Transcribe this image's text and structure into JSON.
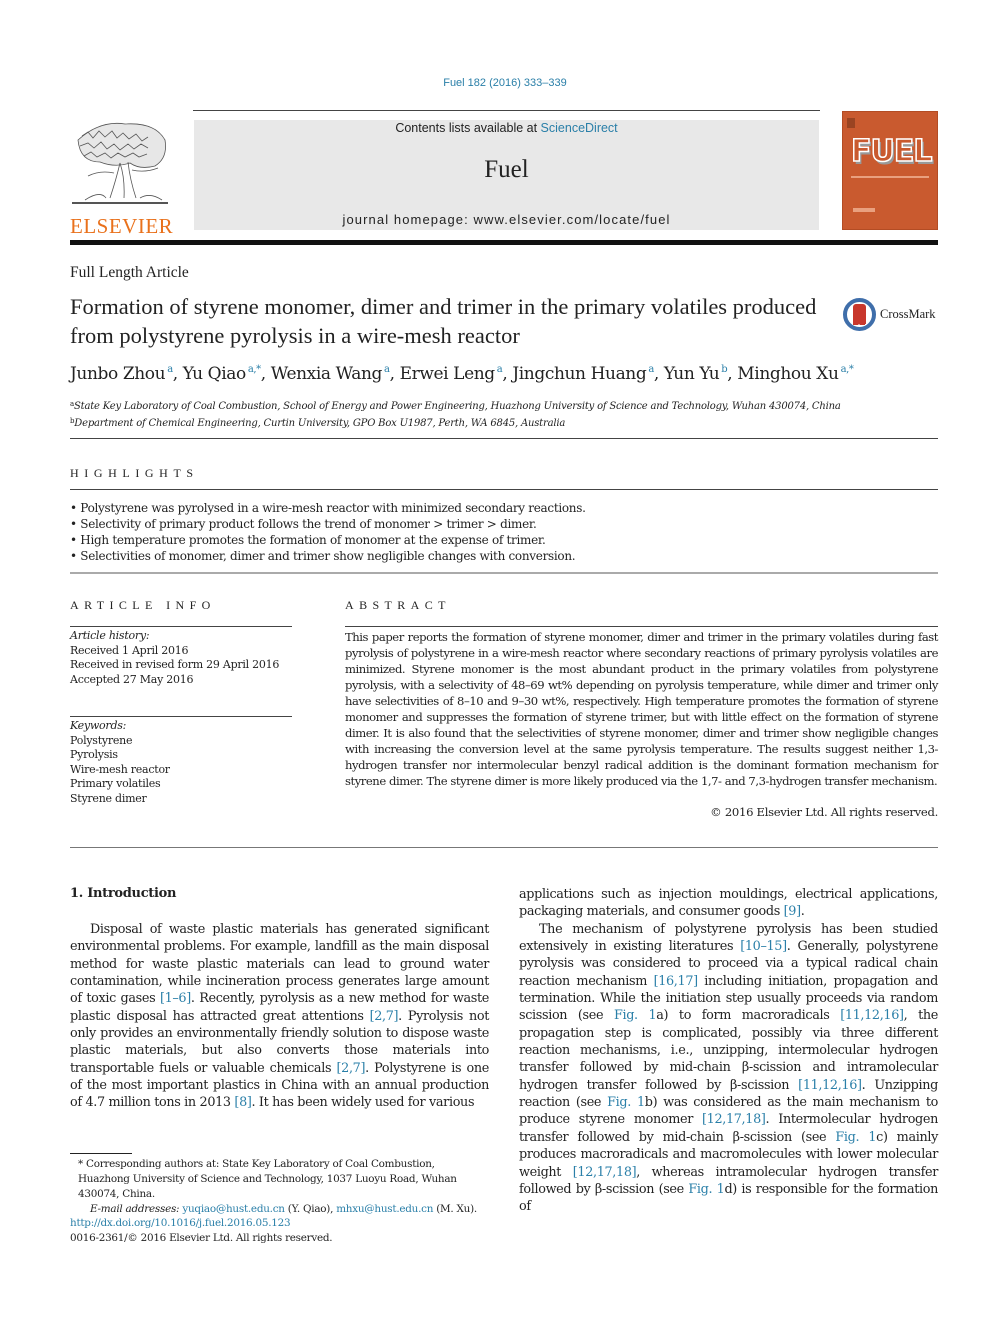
{
  "citation": "Fuel 182 (2016) 333–339",
  "masthead": {
    "contents_prefix": "Contents lists available at ",
    "contents_link": "ScienceDirect",
    "journal_name": "Fuel",
    "homepage": "journal homepage: www.elsevier.com/locate/fuel"
  },
  "publisher_logo": "ELSEVIER",
  "cover": {
    "title": "FUEL"
  },
  "crossmark_label": "CrossMark",
  "article_type": "Full Length Article",
  "title": "Formation of styrene monomer, dimer and trimer in the primary volatiles produced from polystyrene pyrolysis in a wire-mesh reactor",
  "authors": [
    {
      "name": "Junbo Zhou",
      "aff": "a"
    },
    {
      "name": "Yu Qiao",
      "aff": "a,*"
    },
    {
      "name": "Wenxia Wang",
      "aff": "a"
    },
    {
      "name": "Erwei Leng",
      "aff": "a"
    },
    {
      "name": "Jingchun Huang",
      "aff": "a"
    },
    {
      "name": "Yun Yu",
      "aff": "b"
    },
    {
      "name": "Minghou Xu",
      "aff": "a,*"
    }
  ],
  "affiliations": [
    {
      "label": "a",
      "text": "State Key Laboratory of Coal Combustion, School of Energy and Power Engineering, Huazhong University of Science and Technology, Wuhan 430074, China"
    },
    {
      "label": "b",
      "text": "Department of Chemical Engineering, Curtin University, GPO Box U1987, Perth, WA 6845, Australia"
    }
  ],
  "highlights": {
    "title": "HIGHLIGHTS",
    "items": [
      "Polystyrene was pyrolysed in a wire-mesh reactor with minimized secondary reactions.",
      "Selectivity of primary product follows the trend of monomer > trimer > dimer.",
      "High temperature promotes the formation of monomer at the expense of trimer.",
      "Selectivities of monomer, dimer and trimer show negligible changes with conversion."
    ]
  },
  "article_info": {
    "title": "ARTICLE INFO",
    "history_label": "Article history:",
    "history": [
      "Received 1 April 2016",
      "Received in revised form 29 April 2016",
      "Accepted 27 May 2016"
    ],
    "keywords_label": "Keywords:",
    "keywords": [
      "Polystyrene",
      "Pyrolysis",
      "Wire-mesh reactor",
      "Primary volatiles",
      "Styrene dimer"
    ]
  },
  "abstract": {
    "title": "ABSTRACT",
    "text": "This paper reports the formation of styrene monomer, dimer and trimer in the primary volatiles during fast pyrolysis of polystyrene in a wire-mesh reactor where secondary reactions of primary pyrolysis volatiles are minimized. Styrene monomer is the most abundant product in the primary volatiles from polystyrene pyrolysis, with a selectivity of 48–69 wt% depending on pyrolysis temperature, while dimer and trimer only have selectivities of 8–10 and 9–30 wt%, respectively. High temperature promotes the formation of styrene monomer and suppresses the formation of styrene trimer, but with little effect on the formation of styrene dimer. It is also found that the selectivities of styrene monomer, dimer and trimer show negligible changes with increasing the conversion level at the same pyrolysis temperature. The results suggest neither 1,3-hydrogen transfer nor intermolecular benzyl radical addition is the dominant formation mechanism for styrene dimer. The styrene dimer is more likely produced via the 1,7- and 7,3-hydrogen transfer mechanism.",
    "copyright": "© 2016 Elsevier Ltd. All rights reserved."
  },
  "introduction": {
    "heading": "1. Introduction",
    "left_segments": [
      {
        "t": "Disposal of waste plastic materials has generated significant environmental problems. For example, landfill as the main disposal method for waste plastic materials can lead to ground water contamination, while incineration process generates large amount of toxic gases "
      },
      {
        "t": "[1–6]",
        "link": true
      },
      {
        "t": ". Recently, pyrolysis as a new method for waste plastic disposal has attracted great attentions "
      },
      {
        "t": "[2,7]",
        "link": true
      },
      {
        "t": ". Pyrolysis not only provides an environmentally friendly solution to dispose waste plastic materials, but also converts those materials into transportable fuels or valuable chemicals "
      },
      {
        "t": "[2,7]",
        "link": true
      },
      {
        "t": ". Polystyrene is one of the most important plastics in China with an annual production of 4.7 million tons in 2013 "
      },
      {
        "t": "[8]",
        "link": true
      },
      {
        "t": ". It has been widely used for various"
      }
    ],
    "right_p1": [
      {
        "t": "applications such as injection mouldings, electrical applications, packaging materials, and consumer goods "
      },
      {
        "t": "[9]",
        "link": true
      },
      {
        "t": "."
      }
    ],
    "right_p2": [
      {
        "t": "The mechanism of polystyrene pyrolysis has been studied extensively in existing literatures "
      },
      {
        "t": "[10–15]",
        "link": true
      },
      {
        "t": ". Generally, polystyrene pyrolysis was considered to proceed via a typical radical chain reaction mechanism "
      },
      {
        "t": "[16,17]",
        "link": true
      },
      {
        "t": " including initiation, propagation and termination. While the initiation step usually proceeds via random scission (see "
      },
      {
        "t": "Fig. 1",
        "link": true
      },
      {
        "t": "a) to form macroradicals "
      },
      {
        "t": "[11,12,16]",
        "link": true
      },
      {
        "t": ", the propagation step is complicated, possibly via three different reaction mechanisms, i.e., unzipping, intermolecular hydrogen transfer followed by mid-chain β-scission and intramolecular hydrogen transfer followed by β-scission "
      },
      {
        "t": "[11,12,16]",
        "link": true
      },
      {
        "t": ". Unzipping reaction (see "
      },
      {
        "t": "Fig. 1",
        "link": true
      },
      {
        "t": "b) was considered as the main mechanism to produce styrene monomer "
      },
      {
        "t": "[12,17,18]",
        "link": true
      },
      {
        "t": ". Intermolecular hydrogen transfer followed by mid-chain β-scission (see "
      },
      {
        "t": "Fig. 1",
        "link": true
      },
      {
        "t": "c) mainly produces macroradicals and macromolecules with lower molecular weight "
      },
      {
        "t": "[12,17,18]",
        "link": true
      },
      {
        "t": ", whereas intramolecular hydrogen transfer followed by β-scission (see "
      },
      {
        "t": "Fig. 1",
        "link": true
      },
      {
        "t": "d) is responsible for the formation of"
      }
    ]
  },
  "footnote": {
    "corresponding": "* Corresponding authors at: State Key Laboratory of Coal Combustion, Huazhong University of Science and Technology, 1037 Luoyu Road, Wuhan 430074, China.",
    "email_label": "E-mail addresses:",
    "emails": [
      {
        "address": "yuqiao@hust.edu.cn",
        "who": " (Y. Qiao), "
      },
      {
        "address": "mhxu@hust.edu.cn",
        "who": " (M. Xu)."
      }
    ],
    "doi": "http://dx.doi.org/10.1016/j.fuel.2016.05.123",
    "issn_line": "0016-2361/© 2016 Elsevier Ltd. All rights reserved."
  },
  "colors": {
    "link": "#2a7fa8",
    "elsevier_orange": "#e9711c",
    "cover": "#c95a2f",
    "masthead_bg": "#e8e8e8"
  }
}
